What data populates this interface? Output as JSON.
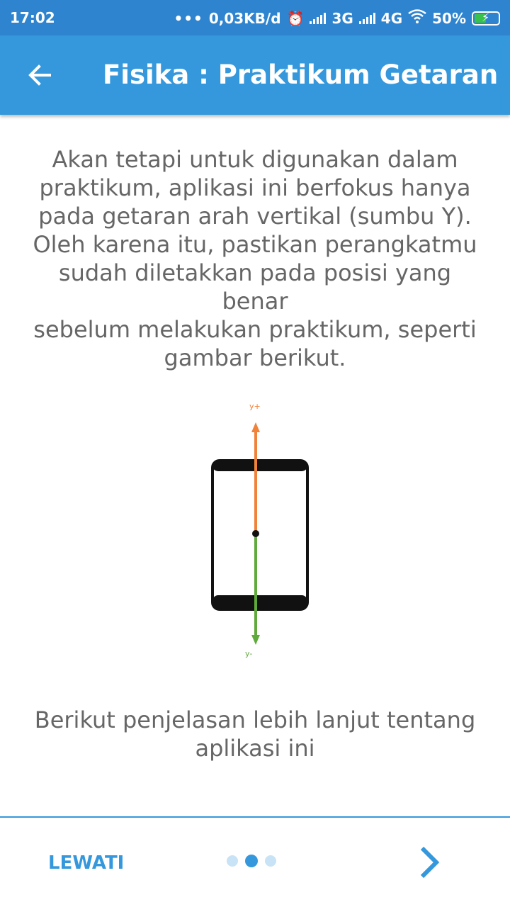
{
  "status": {
    "time": "17:02",
    "dots": "•••",
    "net_speed": "0,03KB/d",
    "net1": "3G",
    "net2": "4G",
    "battery": "50%"
  },
  "app_bar": {
    "title": "Fisika : Praktikum Getaran"
  },
  "content": {
    "paragraph_lines": [
      "Akan tetapi untuk digunakan dalam",
      "praktikum, aplikasi ini berfokus hanya",
      "pada getaran arah vertikal (sumbu Y).",
      "Oleh karena itu, pastikan perangkatmu",
      "sudah diletakkan pada posisi yang benar",
      "sebelum melakukan praktikum, seperti",
      "gambar berikut."
    ],
    "figure": {
      "y_plus_label": "y+",
      "y_minus_label": "y-",
      "up_color": "#f0823a",
      "down_color": "#5faa3c"
    },
    "caption_lines": [
      "Berikut penjelasan lebih lanjut tentang",
      "aplikasi ini"
    ]
  },
  "footer": {
    "skip_label": "LEWATI",
    "pager_total": 3,
    "pager_active": 2
  },
  "colors": {
    "primary": "#3598dc",
    "status_bar": "#2e84cf",
    "text": "#666666"
  }
}
